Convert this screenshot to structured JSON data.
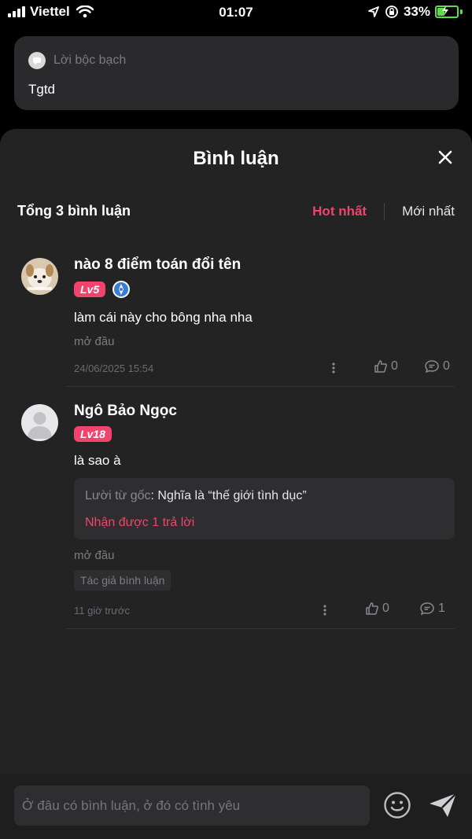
{
  "status": {
    "carrier": "Viettel",
    "time": "01:07",
    "battery_pct": "33%",
    "battery_level": 0.33
  },
  "confession": {
    "label": "Lời bộc bạch",
    "text": "Tgtd"
  },
  "sheet": {
    "title": "Bình luận",
    "summary": "Tổng 3 bình luận",
    "sort_hot": "Hot nhất",
    "sort_new": "Mới nhất"
  },
  "comments": [
    {
      "name": "nào 8 điểm toán đổi tên",
      "level": "Lv5",
      "text": "làm cái này cho bông nha nha",
      "location": "mở đầu",
      "timestamp": "24/06/2025 15:54",
      "likes": "0",
      "replies": "0"
    },
    {
      "name": "Ngô Bảo Ngọc",
      "level": "Lv18",
      "text": "là sao à",
      "quote_source": "Lười từ gốc",
      "quote_text": ": Nghĩa là “thế giới tình dục”",
      "quote_replies": "Nhận được 1 trả lời",
      "location": "mở đầu",
      "author_tag": "Tác giả bình luận",
      "timestamp": "11 giờ trước",
      "likes": "0",
      "replies": "1"
    }
  ],
  "input": {
    "placeholder": "Ở đâu có bình luận, ở đó có tình yêu"
  },
  "colors": {
    "accent": "#f2436c",
    "sheet_bg": "#232324",
    "card_bg": "#2a2a2c"
  }
}
